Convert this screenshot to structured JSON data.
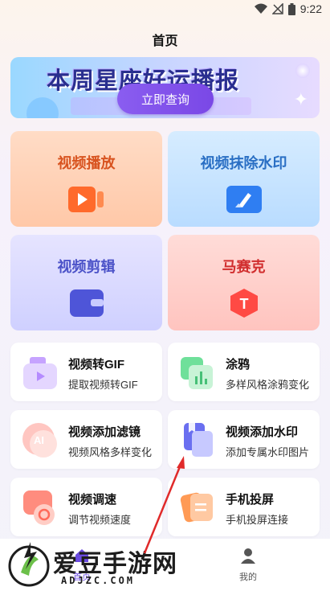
{
  "status_bar": {
    "time": "9:22",
    "icons": [
      "wifi-icon",
      "signal-icon",
      "battery-icon"
    ]
  },
  "header": {
    "title": "首页"
  },
  "banner": {
    "headline": "本周星座好运播报",
    "button_label": "立即查询"
  },
  "feature_cards": [
    {
      "label": "视频播放",
      "icon": "play-icon",
      "color": "#d8531f"
    },
    {
      "label": "视频抹除水印",
      "icon": "eraser-icon",
      "color": "#2a6fc4"
    },
    {
      "label": "视频剪辑",
      "icon": "wallet-icon",
      "color": "#4b52c8"
    },
    {
      "label": "马赛克",
      "icon": "mosaic-icon",
      "color": "#d12e2e"
    }
  ],
  "tools": [
    {
      "title": "视频转GIF",
      "subtitle": "提取视频转GIF",
      "icon": "gif-icon"
    },
    {
      "title": "涂鸦",
      "subtitle": "多样风格涂鸦变化",
      "icon": "chart-icon"
    },
    {
      "title": "视频添加滤镜",
      "subtitle": "视频风格多样变化",
      "icon": "ai-filter-icon"
    },
    {
      "title": "视频添加水印",
      "subtitle": "添加专属水印图片",
      "icon": "document-icon"
    },
    {
      "title": "视频调速",
      "subtitle": "调节视频速度",
      "icon": "speed-icon"
    },
    {
      "title": "手机投屏",
      "subtitle": "手机投屏连接",
      "icon": "cast-icon"
    }
  ],
  "tabbar": {
    "home": "首页",
    "mine": "我的"
  },
  "watermark": {
    "name": "爱豆手游网",
    "domain": "ADJZC.COM"
  }
}
